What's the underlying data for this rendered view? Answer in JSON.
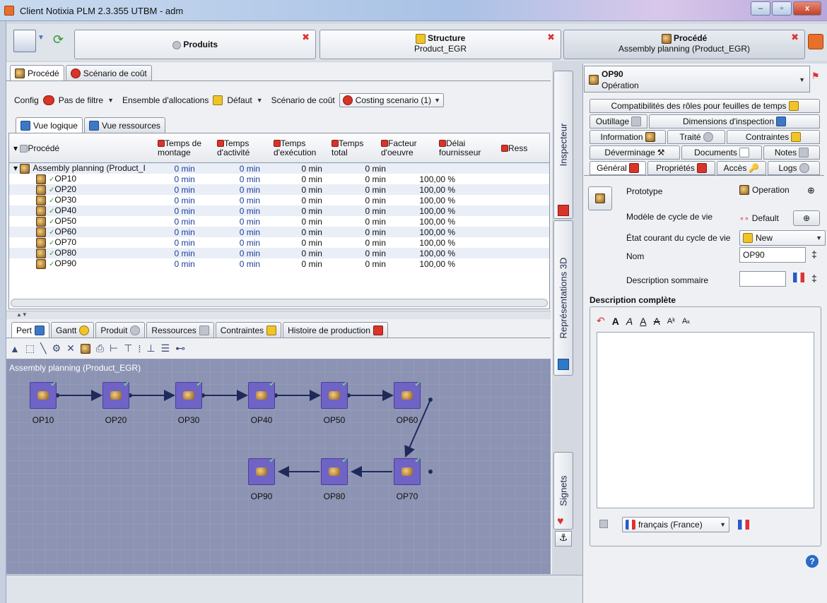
{
  "window": {
    "title": "Client Notixia PLM 2.3.355 UTBM - adm",
    "min": "–",
    "max": "▫",
    "close": "x"
  },
  "doctabs": [
    {
      "title": "Produits",
      "subtitle": ""
    },
    {
      "title": "Structure",
      "subtitle": "Product_EGR"
    },
    {
      "title": "Procédé",
      "subtitle": "Assembly planning (Product_EGR)"
    }
  ],
  "left": {
    "tabs": [
      "Procédé",
      "Scénario de coût"
    ],
    "config": {
      "config_label": "Config",
      "filter_value": "Pas de filtre",
      "alloc_label": "Ensemble d'allocations",
      "alloc_value": "Défaut",
      "scenario_label": "Scénario de coût",
      "scenario_value": "Costing scenario (1)"
    },
    "view_tabs": [
      "Vue logique",
      "Vue ressources"
    ],
    "table": {
      "headers": [
        "Procédé",
        "Temps de montage",
        "Temps d'activité",
        "Temps d'exécution",
        "Temps total",
        "Facteur d'oeuvre",
        "Délai fournisseur",
        "Ress"
      ],
      "rows": [
        [
          "Assembly planning (Product_I",
          "0 min",
          "0 min",
          "0 min",
          "0 min",
          "",
          ""
        ],
        [
          "OP10",
          "0 min",
          "0 min",
          "0 min",
          "0 min",
          "100,00 %",
          ""
        ],
        [
          "OP20",
          "0 min",
          "0 min",
          "0 min",
          "0 min",
          "100,00 %",
          ""
        ],
        [
          "OP30",
          "0 min",
          "0 min",
          "0 min",
          "0 min",
          "100,00 %",
          ""
        ],
        [
          "OP40",
          "0 min",
          "0 min",
          "0 min",
          "0 min",
          "100,00 %",
          ""
        ],
        [
          "OP50",
          "0 min",
          "0 min",
          "0 min",
          "0 min",
          "100,00 %",
          ""
        ],
        [
          "OP60",
          "0 min",
          "0 min",
          "0 min",
          "0 min",
          "100,00 %",
          ""
        ],
        [
          "OP70",
          "0 min",
          "0 min",
          "0 min",
          "0 min",
          "100,00 %",
          ""
        ],
        [
          "OP80",
          "0 min",
          "0 min",
          "0 min",
          "0 min",
          "100,00 %",
          ""
        ],
        [
          "OP90",
          "0 min",
          "0 min",
          "0 min",
          "0 min",
          "100,00 %",
          ""
        ]
      ]
    },
    "bottom_tabs": [
      "Pert",
      "Gantt",
      "Produit",
      "Ressources",
      "Contraintes",
      "Histoire de production"
    ],
    "pert": {
      "root_label": "Assembly planning (Product_EGR)",
      "nodes": [
        "OP10",
        "OP20",
        "OP30",
        "OP40",
        "OP50",
        "OP60",
        "OP70",
        "OP80",
        "OP90"
      ]
    }
  },
  "vtabs": [
    "Inspecteur",
    "Représentations 3D",
    "Signets"
  ],
  "right": {
    "header": {
      "title": "OP90",
      "subtitle": "Opération"
    },
    "tabs_row1": [
      "Compatibilités des rôles pour feuilles de temps"
    ],
    "tabs_row2": [
      "Outillage",
      "Dimensions d'inspection"
    ],
    "tabs_row3": [
      "Information",
      "Traité",
      "Contraintes"
    ],
    "tabs_row4": [
      "Déverminage",
      "Documents",
      "Notes"
    ],
    "tabs_row5": [
      "Général",
      "Propriétés",
      "Accès",
      "Logs"
    ],
    "general": {
      "prototype_label": "Prototype",
      "prototype_value": "Operation",
      "lifecycle_label": "Modèle de cycle de vie",
      "lifecycle_value": "Default",
      "state_label": "État courant du cycle de vie",
      "state_value": "New",
      "name_label": "Nom",
      "name_value": "OP90",
      "summary_label": "Description sommaire",
      "summary_value": "",
      "full_desc_label": "Description complète",
      "language_value": "français (France)"
    }
  },
  "colors": {
    "accent": "#6f63c6",
    "pert_bg": "#8c93b3",
    "link_blue": "#1c3f9a"
  }
}
